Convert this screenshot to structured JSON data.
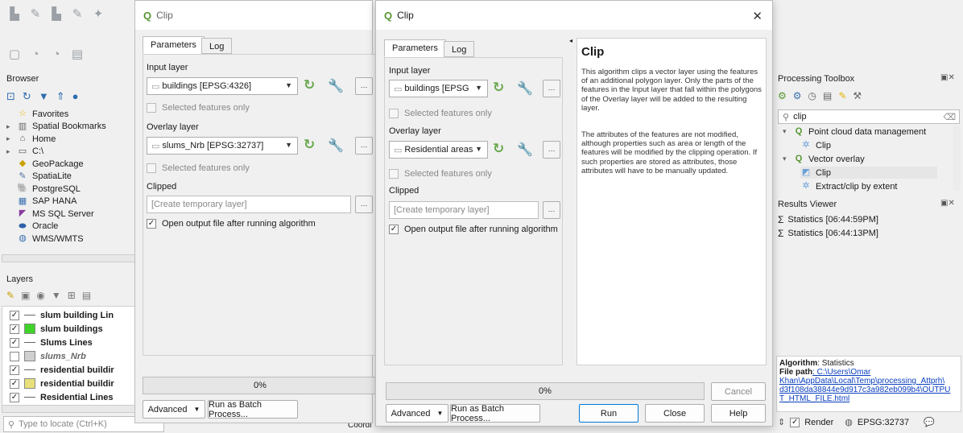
{
  "left": {
    "browser_title": "Browser",
    "browser_items": [
      {
        "label": "Favorites",
        "icon": "star-icon",
        "glyph": "☆",
        "color": "#e6b400",
        "arrow": ""
      },
      {
        "label": "Spatial Bookmarks",
        "icon": "bookmark-icon",
        "glyph": "▥",
        "color": "#666",
        "arrow": "▸"
      },
      {
        "label": "Home",
        "icon": "home-folder-icon",
        "glyph": "⌂",
        "color": "#555",
        "arrow": "▸"
      },
      {
        "label": "C:\\",
        "icon": "drive-icon",
        "glyph": "▭",
        "color": "#555",
        "arrow": "▸"
      },
      {
        "label": "GeoPackage",
        "icon": "geopackage-icon",
        "glyph": "◆",
        "color": "#c9a100",
        "arrow": ""
      },
      {
        "label": "SpatiaLite",
        "icon": "spatialite-icon",
        "glyph": "✎",
        "color": "#4a6fa5",
        "arrow": ""
      },
      {
        "label": "PostgreSQL",
        "icon": "postgresql-icon",
        "glyph": "🐘",
        "color": "#33618f",
        "arrow": ""
      },
      {
        "label": "SAP HANA",
        "icon": "sap-hana-icon",
        "glyph": "▦",
        "color": "#3a70b0",
        "arrow": ""
      },
      {
        "label": "MS SQL Server",
        "icon": "mssql-icon",
        "glyph": "◤",
        "color": "#8a3ba0",
        "arrow": ""
      },
      {
        "label": "Oracle",
        "icon": "oracle-icon",
        "glyph": "⬬",
        "color": "#2f62a8",
        "arrow": ""
      },
      {
        "label": "WMS/WMTS",
        "icon": "wms-icon",
        "glyph": "◍",
        "color": "#3a70b0",
        "arrow": ""
      }
    ],
    "layers_title": "Layers",
    "layers": [
      {
        "label": "slum building Lin",
        "bold": true,
        "italic": false,
        "checked": true,
        "swatch": "line",
        "color": "#666"
      },
      {
        "label": "slum buildings",
        "bold": true,
        "italic": false,
        "checked": true,
        "swatch": "fill",
        "color": "#3fd32a"
      },
      {
        "label": "Slums Lines",
        "bold": true,
        "italic": false,
        "checked": true,
        "swatch": "line",
        "color": "#666"
      },
      {
        "label": "slums_Nrb",
        "bold": true,
        "italic": true,
        "checked": false,
        "swatch": "fill",
        "color": "#cfcfcf"
      },
      {
        "label": "residential buildir",
        "bold": true,
        "italic": false,
        "checked": true,
        "swatch": "line",
        "color": "#666"
      },
      {
        "label": "residential buildir",
        "bold": true,
        "italic": false,
        "checked": true,
        "swatch": "fill",
        "color": "#e8e07a"
      },
      {
        "label": "Residential Lines",
        "bold": true,
        "italic": false,
        "checked": true,
        "swatch": "line",
        "color": "#666"
      }
    ],
    "locate_placeholder": "Type to locate (Ctrl+K)"
  },
  "dialog1": {
    "title": "Clip",
    "tab_parameters": "Parameters",
    "tab_log": "Log",
    "input_layer_label": "Input layer",
    "input_layer_value": "buildings [EPSG:4326]",
    "selected_only_1": "Selected features only",
    "overlay_layer_label": "Overlay layer",
    "overlay_layer_value": "slums_Nrb [EPSG:32737]",
    "selected_only_2": "Selected features only",
    "clipped_label": "Clipped",
    "clipped_placeholder": "[Create temporary layer]",
    "open_output": "Open output file after running algorithm",
    "progress_text": "0%",
    "advanced": "Advanced",
    "batch": "Run as Batch Process..."
  },
  "dialog2": {
    "title": "Clip",
    "tab_parameters": "Parameters",
    "tab_log": "Log",
    "input_layer_label": "Input layer",
    "input_layer_value": "buildings [EPSG",
    "selected_only_1": "Selected features only",
    "overlay_layer_label": "Overlay layer",
    "overlay_layer_value": "Residential areas",
    "selected_only_2": "Selected features only",
    "clipped_label": "Clipped",
    "clipped_placeholder": "[Create temporary layer]",
    "open_output": "Open output file after running algorithm",
    "help_title": "Clip",
    "help_p1": "This algorithm clips a vector layer using the features of an additional polygon layer. Only the parts of the features in the Input layer that fall within the polygons of the Overlay layer will be added to the resulting layer.",
    "help_p2": "The attributes of the features are not modified, although properties such as area or length of the features will be modified by the clipping operation. If such properties are stored as attributes, those attributes will have to be manually updated.",
    "progress_text": "0%",
    "cancel": "Cancel",
    "advanced": "Advanced",
    "batch": "Run as Batch Process...",
    "run": "Run",
    "close": "Close",
    "help": "Help"
  },
  "right": {
    "toolbox_title": "Processing Toolbox",
    "search_value": "clip",
    "tree": [
      {
        "label": "Point cloud data management",
        "indent": 0,
        "icon": "qgis-icon"
      },
      {
        "label": "Clip",
        "indent": 1,
        "icon": "algorithm-icon"
      },
      {
        "label": "Vector overlay",
        "indent": 0,
        "icon": "qgis-icon"
      },
      {
        "label": "Clip",
        "indent": 1,
        "icon": "clip-tool-icon"
      },
      {
        "label": "Extract/clip by extent",
        "indent": 1,
        "icon": "algorithm-icon"
      }
    ],
    "results_title": "Results Viewer",
    "results": [
      "Statistics [06:44:59PM]",
      "Statistics [06:44:13PM]"
    ],
    "algo_label": "Algorithm",
    "algo_value": ": Statistics",
    "path_label": "File path",
    "path_value": ": C:\\Users\\Omar",
    "path_line2": "Khan\\AppData\\Local\\Temp\\processing_Attprh\\",
    "path_line3": "d3f108da38844e9d917c3a982eb099b4\\OUTPU",
    "path_line4": "T_HTML_FILE.html",
    "render_label": "Render",
    "crs_label": "EPSG:32737",
    "coord_label": "Coordi"
  }
}
